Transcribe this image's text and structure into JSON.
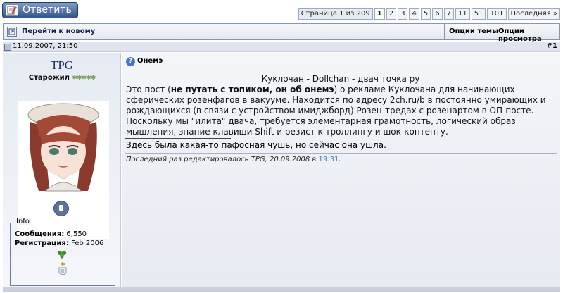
{
  "toolbar": {
    "reply_label": "Ответить"
  },
  "pagination": {
    "label": "Страница 1 из 209",
    "pages": [
      "1",
      "2",
      "3",
      "4",
      "5",
      "6",
      "7",
      "11",
      "51",
      "101"
    ],
    "current": "1",
    "last_label": "Последняя »"
  },
  "nav": {
    "go_newest": "Перейти к новому",
    "thread_tools": "Опции темы",
    "display_modes": "Опции просмотра"
  },
  "post": {
    "date": "11.09.2007, 21:50",
    "number": "#1",
    "subject": "Онемэ",
    "message": {
      "title": "Куклочан - Dollchan - двач точка ру",
      "body_start": "Это пост (",
      "body_bold": "не путать с топиком, он об онемэ",
      "body_rest": ") о рекламе Куклочана для начинающих сферических розенфагов в вакууме. Находится по адресу 2ch.ru/b в постоянно умирающих и рождающихся (в связи с устройством имиджборд) Розен-тредах с розенартом в ОП-посте. Поскольку мы \"илита\" двача, требуется элементарная грамотность, логический образ мышления, знание клавиши Shift и резист к троллингу и шок-контенту."
    },
    "signature": "Здесь была какая-то пафосная чушь, но сейчас она ушла.",
    "edit_note": "Последний раз редактировалось TPG, 20.09.2008 в ",
    "edit_time": "19:31",
    "edit_end": "."
  },
  "user": {
    "name": "TPG",
    "title": "Старожил",
    "title_stars": "✱✱✱✱✱",
    "info_legend": "Info",
    "posts_label": "Сообщения:",
    "posts_value": " 6,550",
    "joined_label": "Регистрация:",
    "joined_value": " Feb 2006"
  },
  "colors": {
    "accent": "#33558f",
    "link": "#1c2a66",
    "time": "#3c78d0"
  }
}
